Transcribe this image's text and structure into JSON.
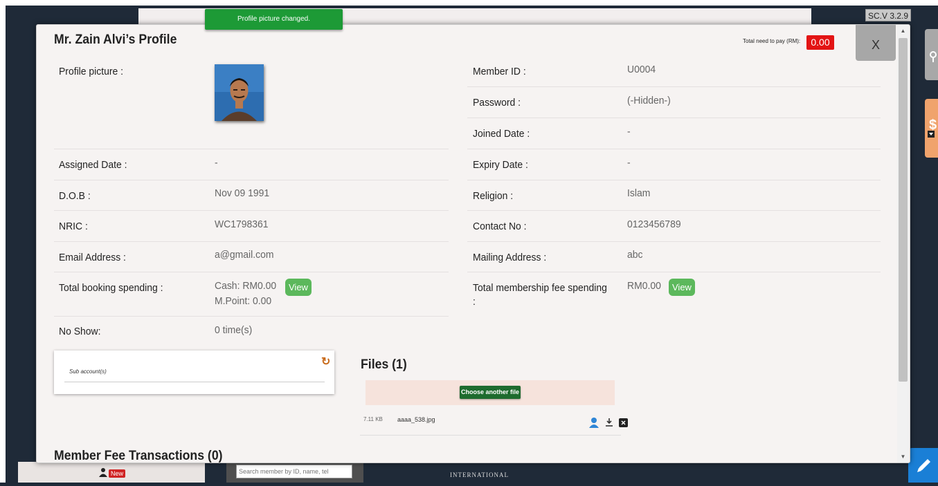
{
  "app": {
    "version": "SC.V 3.2.9"
  },
  "toast": {
    "message": "Profile picture changed."
  },
  "modal": {
    "title": "Mr. Zain Alvi’s Profile",
    "total_pay_label": "Total need to pay (RM):",
    "total_pay_amount": "0.00",
    "close_label": "X"
  },
  "profile": {
    "left": [
      {
        "label": "Profile picture :",
        "value": ""
      },
      {
        "label": "Assigned Date :",
        "value": "-"
      },
      {
        "label": "D.O.B :",
        "value": "Nov 09 1991"
      },
      {
        "label": "NRIC :",
        "value": "WC1798361"
      },
      {
        "label": "Email Address :",
        "value": "a@gmail.com"
      },
      {
        "label": "Total booking spending :",
        "value": "Cash: RM0.00",
        "value2": "M.Point: 0.00",
        "button": "View"
      },
      {
        "label": "No Show:",
        "value": "0 time(s)"
      }
    ],
    "right": [
      {
        "label": "Member ID :",
        "value": "U0004"
      },
      {
        "label": "Password :",
        "value": "(-Hidden-)"
      },
      {
        "label": "Joined Date :",
        "value": "-"
      },
      {
        "label": "Expiry Date :",
        "value": "-"
      },
      {
        "label": "Religion :",
        "value": "Islam"
      },
      {
        "label": "Contact No :",
        "value": "0123456789"
      },
      {
        "label": "Mailing Address :",
        "value": "abc"
      },
      {
        "label": "Total membership fee spending",
        "label2": ":",
        "value": "RM0.00",
        "button": "View"
      }
    ]
  },
  "sub_accounts": {
    "label": "Sub account(s)"
  },
  "files": {
    "title": "Files (1)",
    "choose_button": "Choose another file",
    "items": [
      {
        "size": "7.11 KB",
        "name": "aaaa_538.jpg"
      }
    ]
  },
  "member_fee": {
    "title": "Member Fee Transactions (0)"
  },
  "bottom_bar": {
    "new_badge": "New",
    "search_placeholder": "Search member by ID, name, tel",
    "brand_text": "INTERNATIONAL"
  },
  "colors": {
    "toast_bg": "#1d9a36",
    "pay_badge": "#e31414",
    "view_button": "#5cb85c",
    "choose_button": "#1e6b2e",
    "edit_button": "#1a7fd6"
  },
  "icons": [
    "refresh-icon",
    "user-icon",
    "download-icon",
    "delete-icon",
    "pencil-icon",
    "key-icon",
    "dollar-icon",
    "person-icon"
  ]
}
